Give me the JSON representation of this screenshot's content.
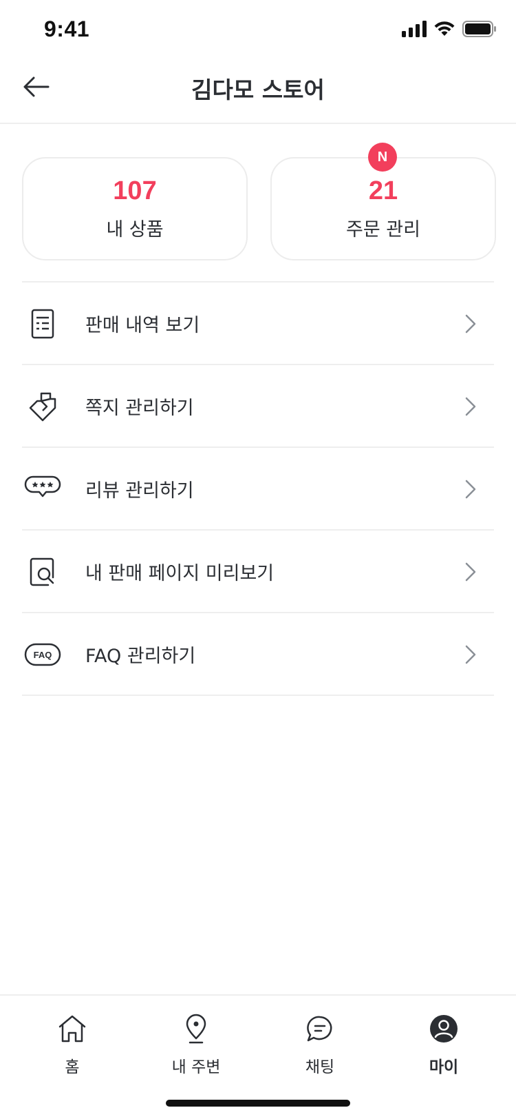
{
  "status_bar": {
    "time": "9:41"
  },
  "header": {
    "title": "김다모 스토어"
  },
  "stats": [
    {
      "value": "107",
      "label": "내 상품"
    },
    {
      "value": "21",
      "label": "주문 관리",
      "badge": "N"
    }
  ],
  "menu": [
    {
      "label": "판매 내역 보기",
      "icon": "receipt-icon"
    },
    {
      "label": "쪽지 관리하기",
      "icon": "message-note-icon"
    },
    {
      "label": "리뷰 관리하기",
      "icon": "review-bubble-icon"
    },
    {
      "label": "내 판매 페이지 미리보기",
      "icon": "page-preview-icon"
    },
    {
      "label": "FAQ 관리하기",
      "icon": "faq-icon",
      "icon_text": "FAQ"
    }
  ],
  "tabs": [
    {
      "label": "홈",
      "icon": "home-icon",
      "active": false
    },
    {
      "label": "내 주변",
      "icon": "location-pin-icon",
      "active": false
    },
    {
      "label": "채팅",
      "icon": "chat-icon",
      "active": false
    },
    {
      "label": "마이",
      "icon": "profile-icon",
      "active": true
    }
  ],
  "colors": {
    "accent": "#f23f5c",
    "text": "#2b2e33",
    "divider": "#eeeeee"
  }
}
